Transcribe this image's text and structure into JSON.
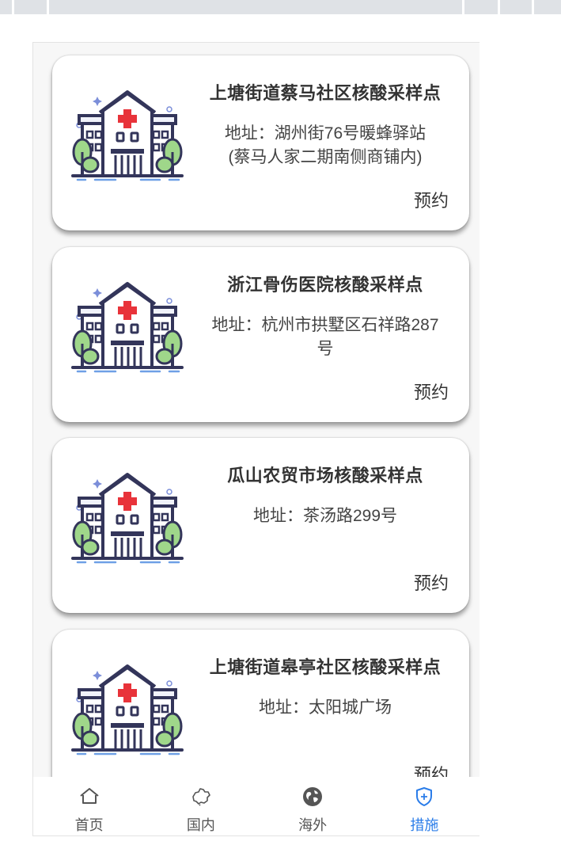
{
  "cards": [
    {
      "title": "上塘街道蔡马社区核酸采样点",
      "address_line1": "地址：湖州街76号暖蜂驿站",
      "address_line2": "(蔡马人家二期南侧商铺内)",
      "book_label": "预约"
    },
    {
      "title": "浙江骨伤医院核酸采样点",
      "address_line1": "地址：杭州市拱墅区石祥路287",
      "address_line2": "号",
      "book_label": "预约"
    },
    {
      "title": "瓜山农贸市场核酸采样点",
      "address_line1": "地址：茶汤路299号",
      "address_line2": "",
      "book_label": "预约"
    },
    {
      "title": "上塘街道皋亭社区核酸采样点",
      "address_line1": "地址：太阳城广场",
      "address_line2": "",
      "book_label": "预约"
    }
  ],
  "tabbar": {
    "items": [
      {
        "label": "首页",
        "icon": "home-icon"
      },
      {
        "label": "国内",
        "icon": "china-map-icon"
      },
      {
        "label": "海外",
        "icon": "globe-icon"
      },
      {
        "label": "措施",
        "icon": "shield-icon"
      }
    ],
    "active_index": 3,
    "active_color": "#2b7de9"
  }
}
